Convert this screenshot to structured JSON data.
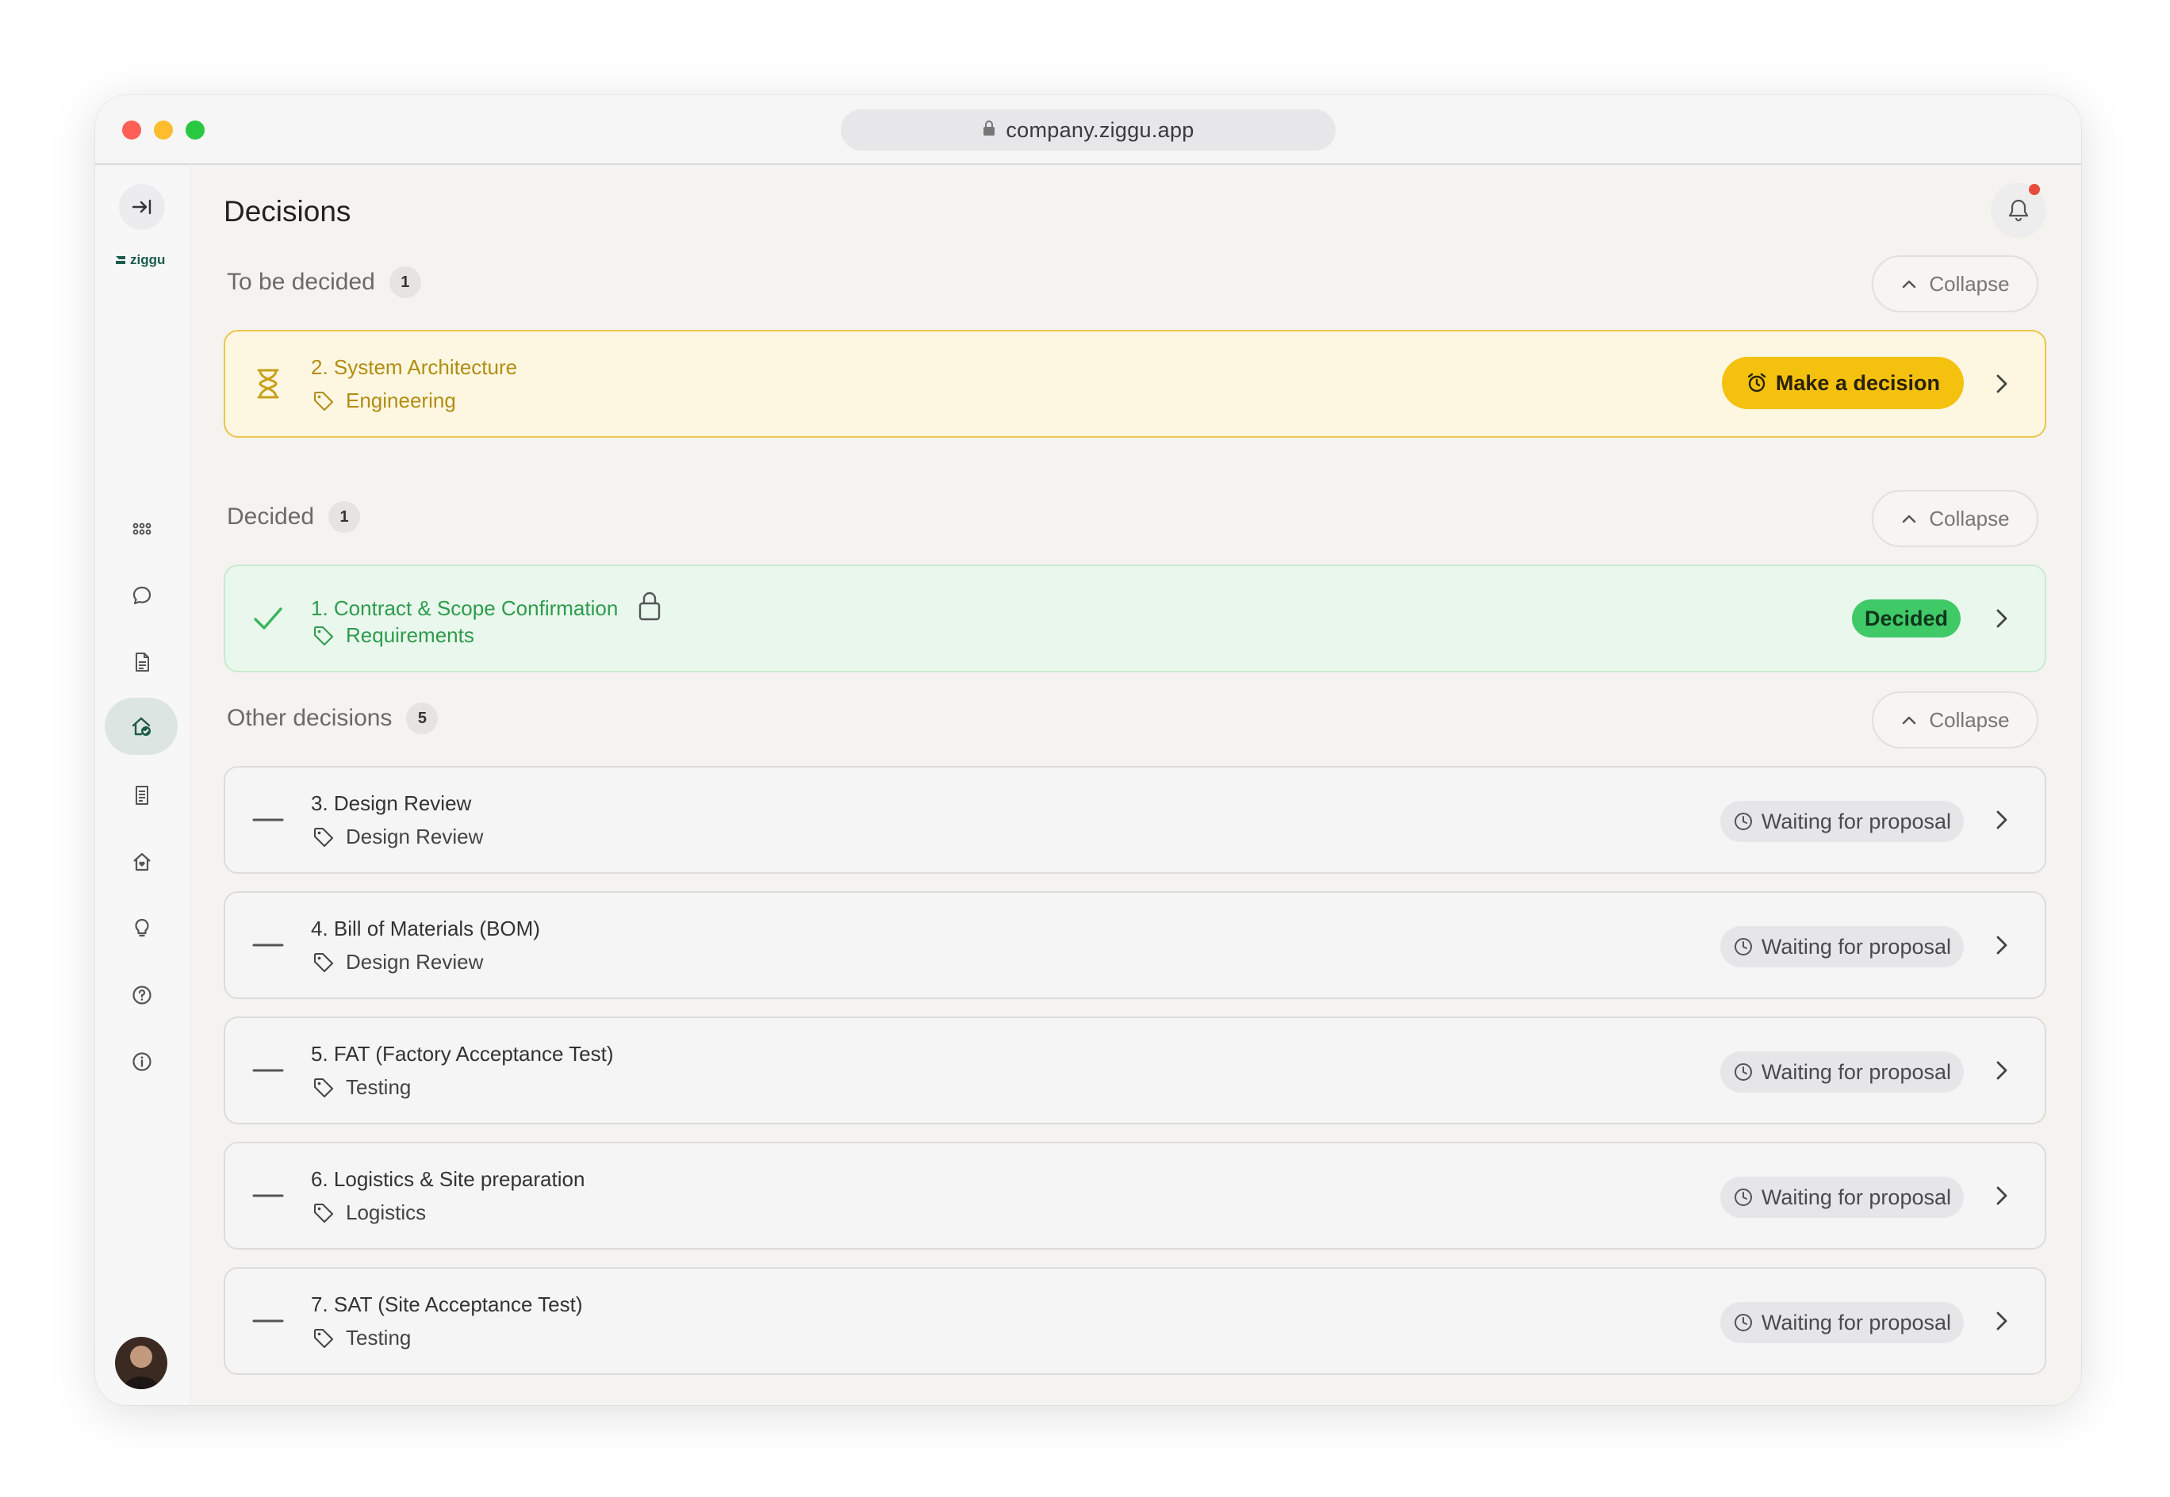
{
  "browser": {
    "url": "company.ziggu.app"
  },
  "sidebar": {
    "logo_text": "ziggu",
    "items": [
      {
        "name": "apps-grid-icon"
      },
      {
        "name": "chat-icon"
      },
      {
        "name": "document-icon"
      },
      {
        "name": "home-check-icon",
        "active": true
      },
      {
        "name": "list-document-icon"
      },
      {
        "name": "home-heart-icon"
      },
      {
        "name": "lightbulb-icon"
      },
      {
        "name": "help-icon"
      },
      {
        "name": "info-icon"
      }
    ]
  },
  "page": {
    "title": "Decisions"
  },
  "sections": {
    "to_be_decided": {
      "label": "To be decided",
      "count": "1",
      "collapse_label": "Collapse"
    },
    "decided": {
      "label": "Decided",
      "count": "1",
      "collapse_label": "Collapse"
    },
    "other": {
      "label": "Other decisions",
      "count": "5",
      "collapse_label": "Collapse"
    }
  },
  "pending_card": {
    "title": "2. System Architecture",
    "tag": "Engineering",
    "action_label": "Make a decision"
  },
  "decided_card": {
    "title": "1. Contract & Scope Confirmation",
    "tag": "Requirements",
    "badge": "Decided"
  },
  "other_cards": [
    {
      "title": "3. Design Review",
      "tag": "Design Review",
      "status": "Waiting for proposal"
    },
    {
      "title": "4. Bill of Materials (BOM)",
      "tag": "Design Review",
      "status": "Waiting for proposal"
    },
    {
      "title": "5. FAT (Factory Acceptance Test)",
      "tag": "Testing",
      "status": "Waiting for proposal"
    },
    {
      "title": "6. Logistics & Site preparation",
      "tag": "Logistics",
      "status": "Waiting for proposal"
    },
    {
      "title": "7. SAT (Site Acceptance Test)",
      "tag": "Testing",
      "status": "Waiting for proposal"
    }
  ],
  "colors": {
    "pending_accent": "#f4c10f",
    "decided_accent": "#3fca67",
    "notification_dot": "#e74c3c",
    "brand": "#1c5c48"
  }
}
